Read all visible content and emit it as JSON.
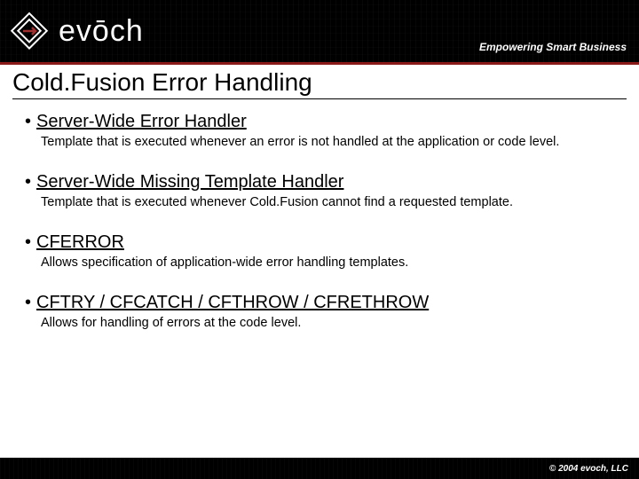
{
  "header": {
    "brand": "evōch",
    "tagline": "Empowering Smart Business"
  },
  "title": "Cold.Fusion Error Handling",
  "items": [
    {
      "title": "Server-Wide Error Handler",
      "desc": "Template that is executed whenever an error is not handled at the application or code level."
    },
    {
      "title": "Server-Wide Missing Template Handler",
      "desc": "Template that is executed whenever Cold.Fusion cannot find a requested template."
    },
    {
      "title": "CFERROR",
      "desc": "Allows specification of application-wide error handling templates."
    },
    {
      "title": "CFTRY / CFCATCH / CFTHROW / CFRETHROW",
      "desc": "Allows for handling of errors at the code level."
    }
  ],
  "footer": {
    "copyright": "© 2004 evoch, LLC"
  }
}
